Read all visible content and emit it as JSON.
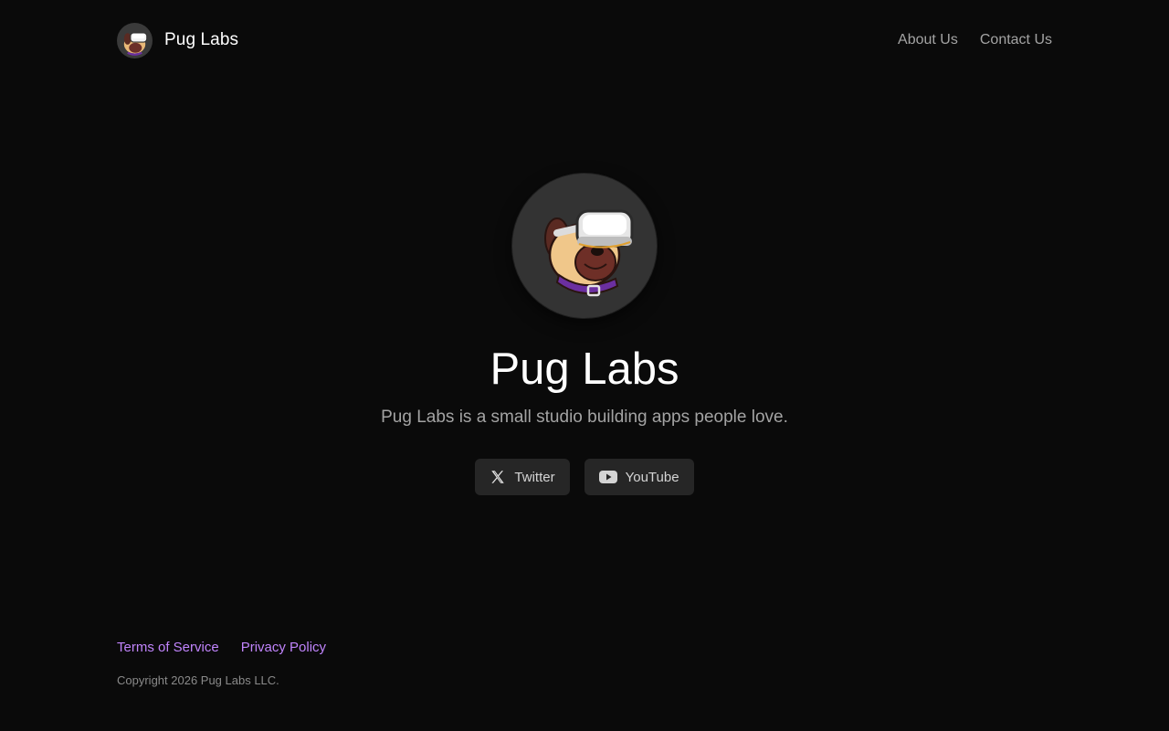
{
  "header": {
    "brand_name": "Pug Labs",
    "nav": [
      {
        "label": "About Us"
      },
      {
        "label": "Contact Us"
      }
    ]
  },
  "hero": {
    "title": "Pug Labs",
    "tagline": "Pug Labs is a small studio building apps people love.",
    "social": [
      {
        "label": "Twitter",
        "icon": "x-icon"
      },
      {
        "label": "YouTube",
        "icon": "youtube-icon"
      }
    ]
  },
  "footer": {
    "links": [
      {
        "label": "Terms of Service"
      },
      {
        "label": "Privacy Policy"
      }
    ],
    "copyright": "Copyright 2026 Pug Labs LLC."
  },
  "colors": {
    "background": "#0a0a0a",
    "button_bg": "#262626",
    "muted_text": "#a3a3a3",
    "footer_link": "#c084fc"
  }
}
